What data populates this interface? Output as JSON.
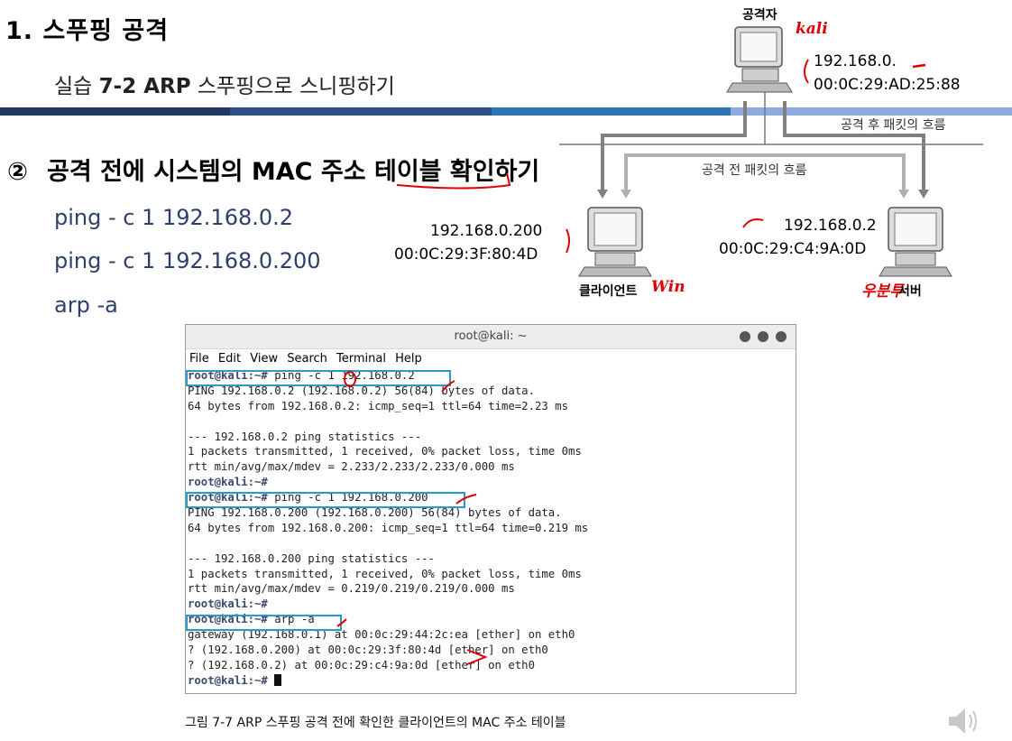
{
  "slide": {
    "title": "1. 스푸핑 공격",
    "subtitle_prefix": "실습 ",
    "subtitle_bold": "7-2 ARP",
    "subtitle_suffix": " 스푸핑으로 스니핑하기",
    "step_number": "②",
    "step_text": "공격 전에 시스템의 MAC 주소 테이블 확인하기",
    "commands": [
      "ping - c 1 192.168.0.2",
      "ping - c 1 192.168.0.200",
      "arp -a"
    ],
    "header_bar_colors": [
      "#1f3864",
      "#2e75b6",
      "#8faadc"
    ]
  },
  "diagram": {
    "attacker": {
      "label": "공격자",
      "ip": "192.168.0.",
      "mac": "00:0C:29:AD:25:88",
      "note": "kali"
    },
    "client": {
      "label": "클라이언트",
      "ip": "192.168.0.200",
      "mac": "00:0C:29:3F:80:4D",
      "note": "Win"
    },
    "server": {
      "label": "서버",
      "ip": "192.168.0.2",
      "mac": "00:0C:29:C4:9A:0D",
      "note": "우분투"
    },
    "flow_after": "공격 후 패킷의 흐름",
    "flow_before": "공격 전 패킷의 흐름",
    "flow_colors": {
      "before": "#a6a6a6",
      "after": "#808080",
      "annotation": "#e00000"
    },
    "icons": [
      "computer-icon"
    ]
  },
  "terminal": {
    "title": "root@kali: ~",
    "menu": [
      "File",
      "Edit",
      "View",
      "Search",
      "Terminal",
      "Help"
    ],
    "lines": [
      {
        "prompt": "root@kali:~#",
        "text": " ping -c 1 192.168.0.2"
      },
      {
        "prompt": "",
        "text": "PING 192.168.0.2 (192.168.0.2) 56(84) bytes of data."
      },
      {
        "prompt": "",
        "text": "64 bytes from 192.168.0.2: icmp_seq=1 ttl=64 time=2.23 ms"
      },
      {
        "prompt": "",
        "text": ""
      },
      {
        "prompt": "",
        "text": "--- 192.168.0.2 ping statistics ---"
      },
      {
        "prompt": "",
        "text": "1 packets transmitted, 1 received, 0% packet loss, time 0ms"
      },
      {
        "prompt": "",
        "text": "rtt min/avg/max/mdev = 2.233/2.233/2.233/0.000 ms"
      },
      {
        "prompt": "root@kali:~#",
        "text": ""
      },
      {
        "prompt": "root@kali:~#",
        "text": " ping -c 1 192.168.0.200"
      },
      {
        "prompt": "",
        "text": "PING 192.168.0.200 (192.168.0.200) 56(84) bytes of data."
      },
      {
        "prompt": "",
        "text": "64 bytes from 192.168.0.200: icmp_seq=1 ttl=64 time=0.219 ms"
      },
      {
        "prompt": "",
        "text": ""
      },
      {
        "prompt": "",
        "text": "--- 192.168.0.200 ping statistics ---"
      },
      {
        "prompt": "",
        "text": "1 packets transmitted, 1 received, 0% packet loss, time 0ms"
      },
      {
        "prompt": "",
        "text": "rtt min/avg/max/mdev = 0.219/0.219/0.219/0.000 ms"
      },
      {
        "prompt": "root@kali:~#",
        "text": ""
      },
      {
        "prompt": "root@kali:~#",
        "text": " arp -a"
      },
      {
        "prompt": "",
        "text": "gateway (192.168.0.1) at 00:0c:29:44:2c:ea [ether] on eth0"
      },
      {
        "prompt": "",
        "text": "? (192.168.0.200) at 00:0c:29:3f:80:4d [ether] on eth0"
      },
      {
        "prompt": "",
        "text": "? (192.168.0.2) at 00:0c:29:c4:9a:0d [ether] on eth0"
      },
      {
        "prompt": "root@kali:~#",
        "text": " "
      }
    ]
  },
  "caption": "그림 7-7  ARP 스푸핑 공격 전에 확인한 클라이언트의 MAC 주소 테이블",
  "speaker_icon": "speaker-icon"
}
